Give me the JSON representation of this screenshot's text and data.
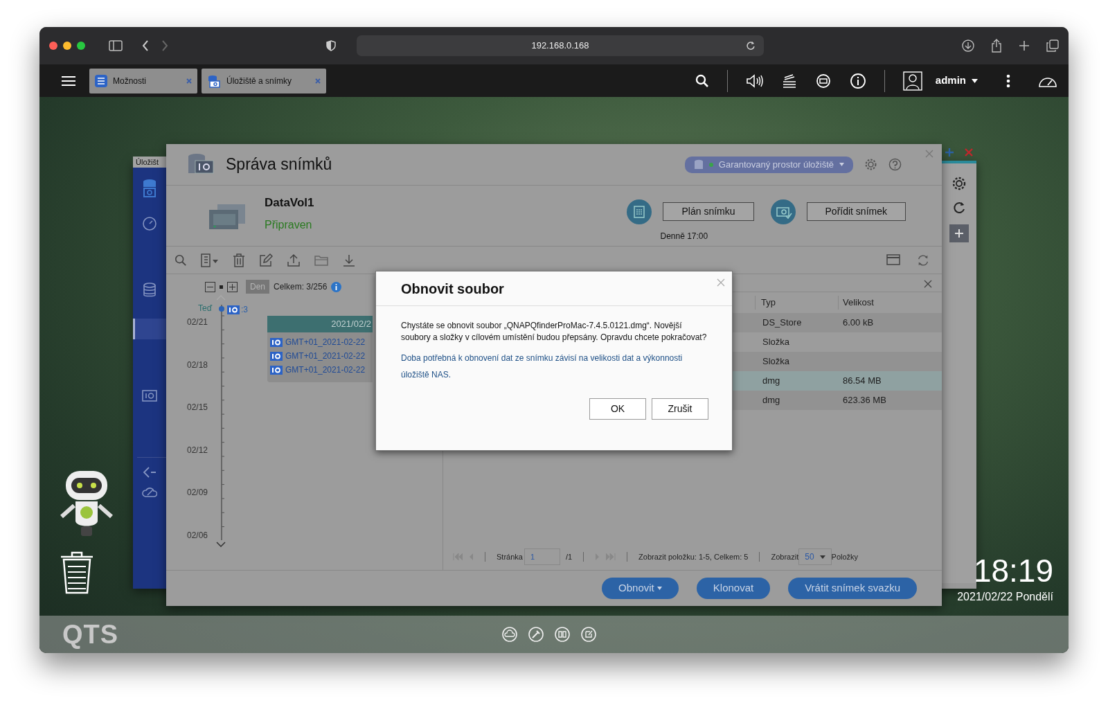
{
  "browser": {
    "address": "192.168.0.168"
  },
  "taskbar": {
    "tabs": [
      {
        "label": "Možnosti"
      },
      {
        "label": "Úložiště a snímky"
      }
    ],
    "user": "admin"
  },
  "background_window": {
    "title": "Úložišt"
  },
  "snapshot_manager": {
    "title": "Správa snímků",
    "storage_badge": "Garantovaný prostor úložiště",
    "volume": {
      "name": "DataVol1",
      "status": "Připraven"
    },
    "schedule_button": "Plán snímku",
    "take_button": "Pořídit snímek",
    "schedule": "Denně 17:00",
    "timeline": {
      "unit": "Den",
      "total": "Celkem: 3/256",
      "now": "Teď",
      "count": ":3",
      "dates": [
        "02/21",
        "02/18",
        "02/15",
        "02/12",
        "02/09",
        "02/06"
      ],
      "group": {
        "date": "2021/02/2",
        "items": [
          "GMT+01_2021-02-22",
          "GMT+01_2021-02-22",
          "GMT+01_2021-02-22"
        ]
      }
    },
    "table": {
      "columns": [
        "Typ",
        "Velikost"
      ],
      "rows": [
        {
          "type": "DS_Store",
          "size": "6.00 kB",
          "selected": false
        },
        {
          "type": "Složka",
          "selected": false
        },
        {
          "type": "Složka",
          "selected": false
        },
        {
          "type": "dmg",
          "size": "86.54 MB",
          "selected": true
        },
        {
          "type": "dmg",
          "size": "623.36 MB",
          "selected": false
        }
      ]
    },
    "pager": {
      "page_label": "Stránka",
      "page": "1",
      "pages": "/1",
      "summary": "Zobrazit položku: 1-5, Celkem: 5",
      "show_label": "Zobrazit",
      "per_page": "50",
      "items_label": "Položky"
    },
    "actions": [
      {
        "label": "Obnovit",
        "kind": "dropdown"
      },
      {
        "label": "Klonovat",
        "kind": "button"
      },
      {
        "label": "Vrátit snímek svazku",
        "kind": "button"
      }
    ]
  },
  "dialog": {
    "title": "Obnovit soubor",
    "message": "Chystáte se obnovit soubor „QNAPQfinderProMac-7.4.5.0121.dmg“. Novější soubory a složky v cílovém umístění budou přepsány. Opravdu chcete pokračovat?",
    "note": "Doba potřebná k obnovení dat ze snímku závisí na velikosti dat a výkonnosti úložiště NAS.",
    "buttons": [
      "OK",
      "Zrušit"
    ]
  },
  "desktop": {
    "time": "18:19",
    "date": "2021/02/22 Pondělí",
    "logo": "QTS"
  }
}
